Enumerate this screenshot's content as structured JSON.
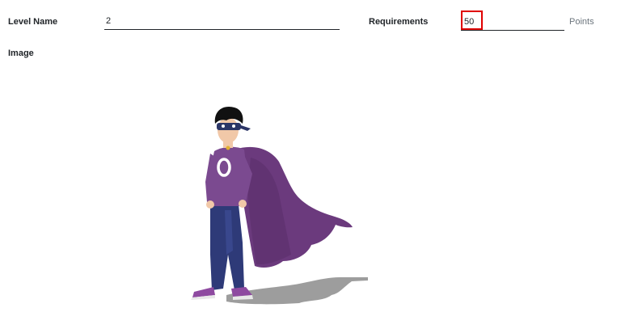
{
  "level_name": {
    "label": "Level Name",
    "value": "2"
  },
  "requirements": {
    "label": "Requirements",
    "value": "50",
    "unit": "Points"
  },
  "image": {
    "label": "Image",
    "icon": "superhero-illustration",
    "colors": {
      "cape": "#6b3a7d",
      "suit": "#7b4a90",
      "pants": "#2e3a78",
      "mask": "#2b3566",
      "hair": "#111111",
      "skin": "#f1c8a8",
      "shadow": "#8c8c8c",
      "boots": "#8e4aa0"
    }
  },
  "colors": {
    "highlight": "#e00000",
    "text": "#212529",
    "muted": "#6c757d"
  }
}
